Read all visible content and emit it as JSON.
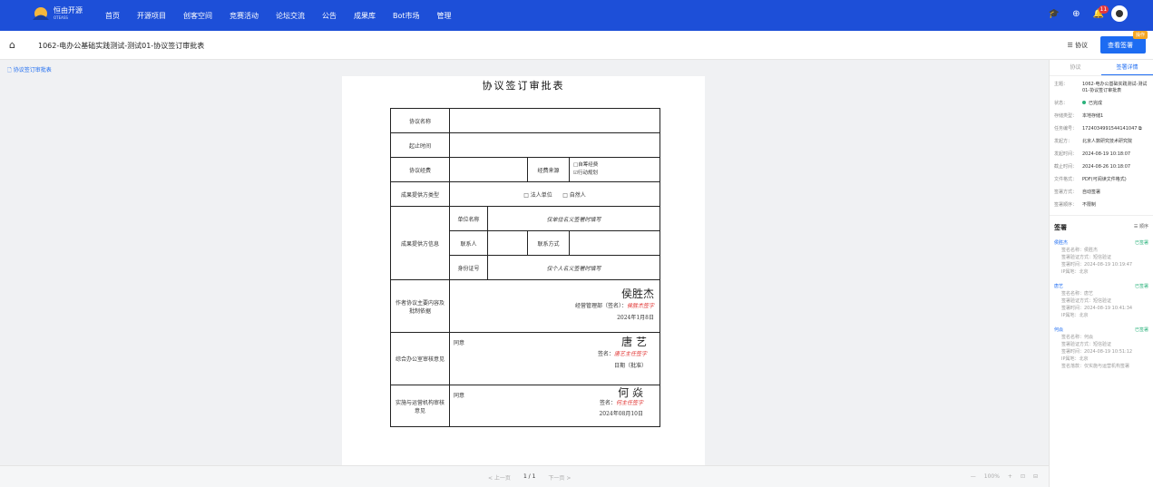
{
  "nav": {
    "logo_line1": "恒由开源",
    "logo_line2": "OTEASS",
    "items": [
      "首页",
      "开源项目",
      "创客空间",
      "竞赛活动",
      "论坛交流",
      "公告",
      "成果库",
      "Bot市场",
      "管理"
    ],
    "badge_count": "11"
  },
  "titlebar": {
    "title": "1062-电办公基础实践测试-测试01-协议签订审批表",
    "chat": "协议",
    "sign_button": "查看签署",
    "sign_tag": "操作"
  },
  "left_link": "协议签订审批表",
  "form": {
    "title": "协议签订审批表",
    "r1": "协议名称",
    "r2": "起止时间",
    "r3": "协议经费",
    "r3b": "经费来源",
    "r3c1": "□自筹经费",
    "r3c2": "☑行动规划",
    "r4": "成果提供方类型",
    "r4a": "□ 法人单位",
    "r4b": "□ 自然人",
    "r5": "成果提供方信息",
    "r5a": "单位名称",
    "r5a_v": "仅单位名义签署时填写",
    "r5b": "联系人",
    "r5c": "联系方式",
    "r5d": "身份证号",
    "r5d_v": "仅个人名义签署时填写",
    "r6": "作者协议主要内容及批制依据",
    "r6_name": "侯胜杰",
    "r6_sign": "经营管理部（签名）：",
    "r6_sig": "侯胜杰签字",
    "r6_date": "2024年1月8日",
    "r7": "综合办公室审核意见",
    "r7_op": "同意",
    "r7_name": "唐 艺",
    "r7_sign": "签名：",
    "r7_sig": "唐艺主任签字",
    "r7_date": "日期（批准）",
    "r8": "实施与运营机构审核意见",
    "r8_op": "同意",
    "r8_name": "何 焱",
    "r8_sign": "签名：",
    "r8_sig": "何主任签字",
    "r8_date": "2024年08月10日"
  },
  "pager": {
    "prev": "< 上一页",
    "page": "1 / 1",
    "next": "下一页 >"
  },
  "zoom": {
    "minus": "—",
    "value": "100%",
    "plus": "+"
  },
  "side": {
    "tab1": "协议",
    "tab2": "签署详情",
    "info": [
      {
        "k": "主题：",
        "v": "1062-电办公基础实践测试-测试01-协议签订审批表"
      },
      {
        "k": "状态：",
        "v": "已完成"
      },
      {
        "k": "存储类型：",
        "v": "本地存储1"
      },
      {
        "k": "任务编号：",
        "v": "1724034991544141047"
      },
      {
        "k": "发起方：",
        "v": "北京人数研究技术研究院"
      },
      {
        "k": "发起时间：",
        "v": "2024-08-19 10:18:07"
      },
      {
        "k": "截止时间：",
        "v": "2024-08-26 10:18:07"
      },
      {
        "k": "文件格式：",
        "v": "PDF(可阅读文件格式)"
      },
      {
        "k": "签署方式：",
        "v": "自动签署"
      },
      {
        "k": "签署顺序：",
        "v": "不限制"
      }
    ],
    "sign_title": "签署",
    "sign_order": "顺序",
    "signers": [
      {
        "name": "侯胜杰",
        "status": "已签署",
        "lines": [
          "签名名称：侯胜杰",
          "签署验证方式：短信验证",
          "签署时间：2024-08-19 10:19:47",
          "IP属地：北京"
        ]
      },
      {
        "name": "唐艺",
        "status": "已签署",
        "lines": [
          "签名名称：唐艺",
          "签署验证方式：短信验证",
          "签署时间：2024-08-19 10:41:34",
          "IP属地：北京"
        ]
      },
      {
        "name": "何焱",
        "status": "已签署",
        "lines": [
          "签名名称：何焱",
          "签署验证方式：短信验证",
          "签署时间：2024-08-19 10:51:12",
          "IP属地：北京",
          "签名落款：仅实施与运营机构签署"
        ]
      }
    ]
  }
}
